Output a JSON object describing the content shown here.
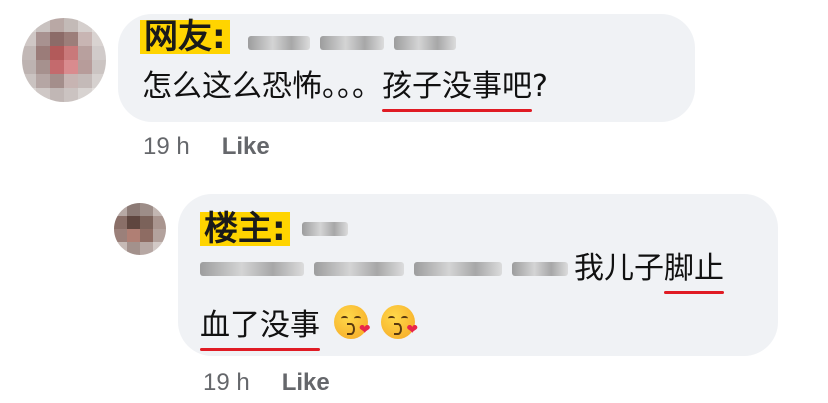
{
  "comments": [
    {
      "tag": "网友:",
      "text_plain": "怎么这么恐怖。。。",
      "text_underlined": "孩子没事吧",
      "text_tail": "?",
      "time": "19 h",
      "like_label": "Like"
    },
    {
      "tag": "楼主:",
      "line1_underlined": "脚止",
      "line1_plain": "我儿子",
      "line2_underlined": "血了没事",
      "emoji_names": [
        "kissing-heart-emoji",
        "kissing-heart-emoji"
      ],
      "time": "19 h",
      "like_label": "Like"
    }
  ],
  "colors": {
    "bubble": "#f0f2f5",
    "tag_highlight": "#ffd400",
    "underline": "#e01b24",
    "meta_text": "#65676b"
  }
}
